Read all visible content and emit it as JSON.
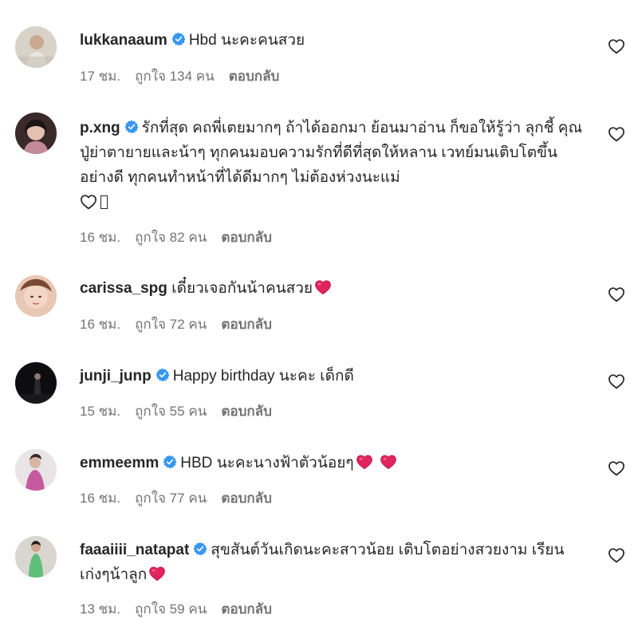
{
  "comments": [
    {
      "username": "lukkanaaum",
      "verified": true,
      "text": "Hbd นะคะคนสวย",
      "time": "17 ชม.",
      "likes": "ถูกใจ 134 คน",
      "reply": "ตอบกลับ"
    },
    {
      "username": "p.xng",
      "verified": true,
      "text": "รักที่สุด คถพี่เตยมากๆ ถ้าได้ออกมา ย้อนมาอ่าน ก็ขอให้รู้ว่า ลุกชี้ คุณปู่ย่าตายายและน้าๆ ทุกคนมอบความรักที่ดีที่สุดให้หลาน เวทย์มนเติบโตขึ้นอย่างดี ทุกคนทำหน้าที่ได้ดีมากๆ ไม่ต้องห่วงนะแม่",
      "time": "16 ชม.",
      "likes": "ถูกใจ 82 คน",
      "reply": "ตอบกลับ"
    },
    {
      "username": "carissa_spg",
      "verified": false,
      "text": "เดี๋ยวเจอกันน้าคนสวย",
      "time": "16 ชม.",
      "likes": "ถูกใจ 72 คน",
      "reply": "ตอบกลับ"
    },
    {
      "username": "junji_junp",
      "verified": true,
      "text": "Happy birthday นะคะ เด็กดี",
      "time": "15 ชม.",
      "likes": "ถูกใจ 55 คน",
      "reply": "ตอบกลับ"
    },
    {
      "username": "emmeemm",
      "verified": true,
      "text": "HBD นะคะนางฟ้าตัวน้อยๆ",
      "time": "16 ชม.",
      "likes": "ถูกใจ 77 คน",
      "reply": "ตอบกลับ"
    },
    {
      "username": "faaaiiii_natapat",
      "verified": true,
      "text": "สุขสันต์วันเกิดนะคะสาวน้อย เติบโตอย่างสวยงาม เรียนเก่งๆน้าลูก",
      "time": "13 ชม.",
      "likes": "ถูกใจ 59 คน",
      "reply": "ตอบกลับ"
    }
  ],
  "colors": {
    "verified": "#3897f0",
    "red_heart": "#e0245e",
    "meta_text": "#737373"
  },
  "icons": {
    "verified": "verified-badge-icon",
    "like": "heart-outline-icon",
    "emoji_heart": "red-heart-emoji",
    "emoji_white_heart": "white-heart-emoji"
  }
}
